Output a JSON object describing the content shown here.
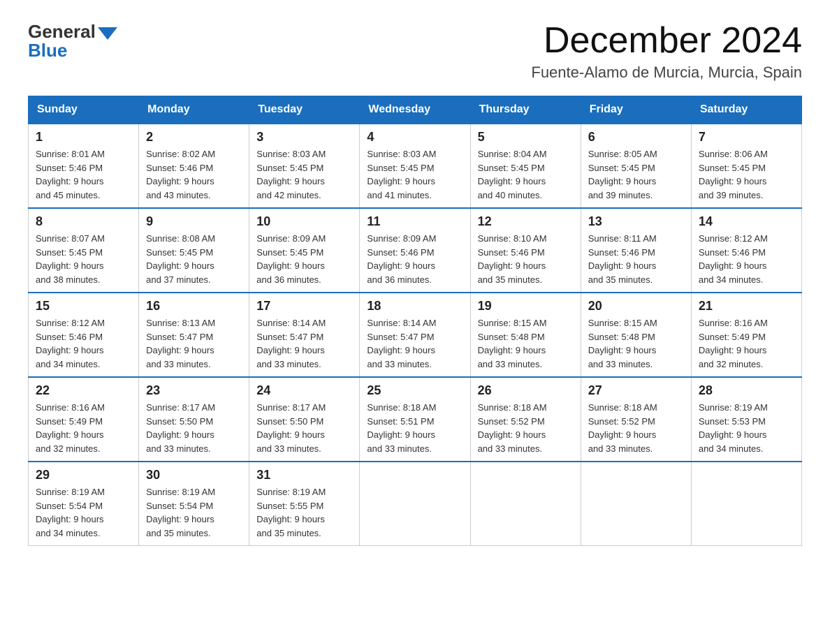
{
  "header": {
    "logo_general": "General",
    "logo_blue": "Blue",
    "main_title": "December 2024",
    "subtitle": "Fuente-Alamo de Murcia, Murcia, Spain"
  },
  "days_of_week": [
    "Sunday",
    "Monday",
    "Tuesday",
    "Wednesday",
    "Thursday",
    "Friday",
    "Saturday"
  ],
  "weeks": [
    [
      {
        "day": "1",
        "sunrise": "8:01 AM",
        "sunset": "5:46 PM",
        "daylight": "9 hours and 45 minutes."
      },
      {
        "day": "2",
        "sunrise": "8:02 AM",
        "sunset": "5:46 PM",
        "daylight": "9 hours and 43 minutes."
      },
      {
        "day": "3",
        "sunrise": "8:03 AM",
        "sunset": "5:45 PM",
        "daylight": "9 hours and 42 minutes."
      },
      {
        "day": "4",
        "sunrise": "8:03 AM",
        "sunset": "5:45 PM",
        "daylight": "9 hours and 41 minutes."
      },
      {
        "day": "5",
        "sunrise": "8:04 AM",
        "sunset": "5:45 PM",
        "daylight": "9 hours and 40 minutes."
      },
      {
        "day": "6",
        "sunrise": "8:05 AM",
        "sunset": "5:45 PM",
        "daylight": "9 hours and 39 minutes."
      },
      {
        "day": "7",
        "sunrise": "8:06 AM",
        "sunset": "5:45 PM",
        "daylight": "9 hours and 39 minutes."
      }
    ],
    [
      {
        "day": "8",
        "sunrise": "8:07 AM",
        "sunset": "5:45 PM",
        "daylight": "9 hours and 38 minutes."
      },
      {
        "day": "9",
        "sunrise": "8:08 AM",
        "sunset": "5:45 PM",
        "daylight": "9 hours and 37 minutes."
      },
      {
        "day": "10",
        "sunrise": "8:09 AM",
        "sunset": "5:45 PM",
        "daylight": "9 hours and 36 minutes."
      },
      {
        "day": "11",
        "sunrise": "8:09 AM",
        "sunset": "5:46 PM",
        "daylight": "9 hours and 36 minutes."
      },
      {
        "day": "12",
        "sunrise": "8:10 AM",
        "sunset": "5:46 PM",
        "daylight": "9 hours and 35 minutes."
      },
      {
        "day": "13",
        "sunrise": "8:11 AM",
        "sunset": "5:46 PM",
        "daylight": "9 hours and 35 minutes."
      },
      {
        "day": "14",
        "sunrise": "8:12 AM",
        "sunset": "5:46 PM",
        "daylight": "9 hours and 34 minutes."
      }
    ],
    [
      {
        "day": "15",
        "sunrise": "8:12 AM",
        "sunset": "5:46 PM",
        "daylight": "9 hours and 34 minutes."
      },
      {
        "day": "16",
        "sunrise": "8:13 AM",
        "sunset": "5:47 PM",
        "daylight": "9 hours and 33 minutes."
      },
      {
        "day": "17",
        "sunrise": "8:14 AM",
        "sunset": "5:47 PM",
        "daylight": "9 hours and 33 minutes."
      },
      {
        "day": "18",
        "sunrise": "8:14 AM",
        "sunset": "5:47 PM",
        "daylight": "9 hours and 33 minutes."
      },
      {
        "day": "19",
        "sunrise": "8:15 AM",
        "sunset": "5:48 PM",
        "daylight": "9 hours and 33 minutes."
      },
      {
        "day": "20",
        "sunrise": "8:15 AM",
        "sunset": "5:48 PM",
        "daylight": "9 hours and 33 minutes."
      },
      {
        "day": "21",
        "sunrise": "8:16 AM",
        "sunset": "5:49 PM",
        "daylight": "9 hours and 32 minutes."
      }
    ],
    [
      {
        "day": "22",
        "sunrise": "8:16 AM",
        "sunset": "5:49 PM",
        "daylight": "9 hours and 32 minutes."
      },
      {
        "day": "23",
        "sunrise": "8:17 AM",
        "sunset": "5:50 PM",
        "daylight": "9 hours and 33 minutes."
      },
      {
        "day": "24",
        "sunrise": "8:17 AM",
        "sunset": "5:50 PM",
        "daylight": "9 hours and 33 minutes."
      },
      {
        "day": "25",
        "sunrise": "8:18 AM",
        "sunset": "5:51 PM",
        "daylight": "9 hours and 33 minutes."
      },
      {
        "day": "26",
        "sunrise": "8:18 AM",
        "sunset": "5:52 PM",
        "daylight": "9 hours and 33 minutes."
      },
      {
        "day": "27",
        "sunrise": "8:18 AM",
        "sunset": "5:52 PM",
        "daylight": "9 hours and 33 minutes."
      },
      {
        "day": "28",
        "sunrise": "8:19 AM",
        "sunset": "5:53 PM",
        "daylight": "9 hours and 34 minutes."
      }
    ],
    [
      {
        "day": "29",
        "sunrise": "8:19 AM",
        "sunset": "5:54 PM",
        "daylight": "9 hours and 34 minutes."
      },
      {
        "day": "30",
        "sunrise": "8:19 AM",
        "sunset": "5:54 PM",
        "daylight": "9 hours and 35 minutes."
      },
      {
        "day": "31",
        "sunrise": "8:19 AM",
        "sunset": "5:55 PM",
        "daylight": "9 hours and 35 minutes."
      },
      null,
      null,
      null,
      null
    ]
  ],
  "labels": {
    "sunrise": "Sunrise:",
    "sunset": "Sunset:",
    "daylight": "Daylight:"
  }
}
